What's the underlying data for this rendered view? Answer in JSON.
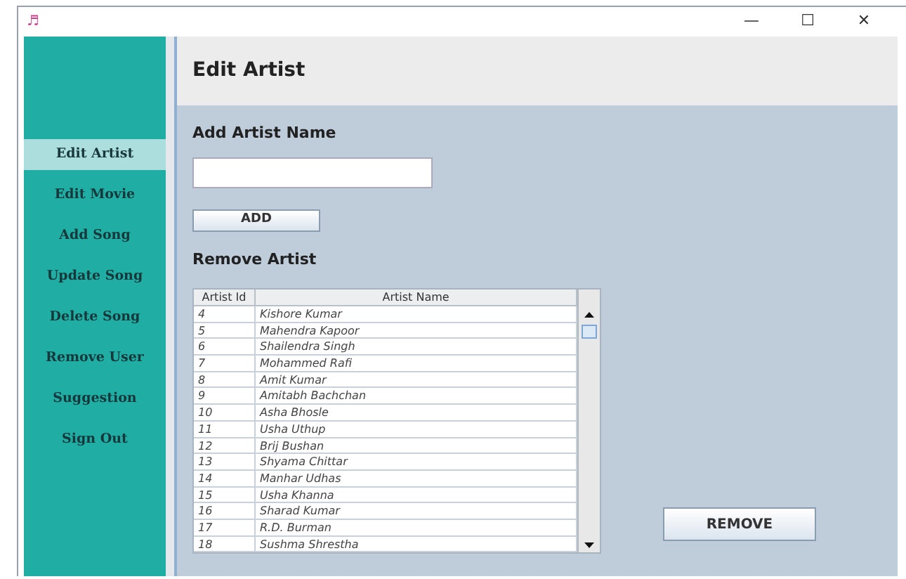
{
  "window": {
    "title_icon": "♬",
    "controls": [
      "—",
      "☐",
      "✕"
    ]
  },
  "sidebar": {
    "items": [
      {
        "label": "Edit Artist",
        "selected": true
      },
      {
        "label": "Edit Movie",
        "selected": false
      },
      {
        "label": "Add Song",
        "selected": false
      },
      {
        "label": "Update Song",
        "selected": false
      },
      {
        "label": "Delete Song",
        "selected": false
      },
      {
        "label": "Remove User",
        "selected": false
      },
      {
        "label": "Suggestion",
        "selected": false
      },
      {
        "label": "Sign Out",
        "selected": false
      }
    ]
  },
  "header": {
    "title": "Edit Artist"
  },
  "add_section": {
    "heading": "Add Artist Name",
    "button": "ADD"
  },
  "remove_section": {
    "heading": "Remove Artist",
    "button": "REMOVE",
    "table": {
      "columns": [
        "Artist Id",
        "Artist Name"
      ],
      "rows": [
        [
          "4",
          "Kishore Kumar"
        ],
        [
          "5",
          "Mahendra Kapoor"
        ],
        [
          "6",
          "Shailendra Singh"
        ],
        [
          "7",
          "Mohammed Rafi"
        ],
        [
          "8",
          "Amit Kumar"
        ],
        [
          "9",
          "Amitabh Bachchan"
        ],
        [
          "10",
          "Asha Bhosle"
        ],
        [
          "11",
          "Usha Uthup"
        ],
        [
          "12",
          "Brij Bushan"
        ],
        [
          "13",
          "Shyama Chittar"
        ],
        [
          "14",
          "Manhar Udhas"
        ],
        [
          "15",
          "Usha Khanna"
        ],
        [
          "16",
          "Sharad Kumar"
        ],
        [
          "17",
          "R.D. Burman"
        ],
        [
          "18",
          "Sushma Shrestha"
        ]
      ]
    }
  }
}
